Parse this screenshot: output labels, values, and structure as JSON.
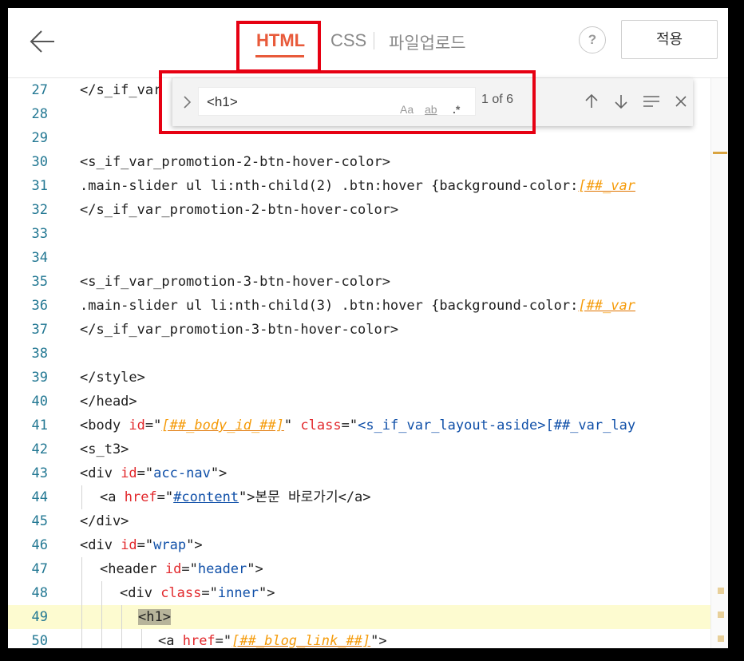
{
  "header": {
    "tabs": [
      {
        "label": "HTML",
        "active": true
      },
      {
        "label": "CSS",
        "active": false
      },
      {
        "label": "파일업로드",
        "active": false
      }
    ],
    "help_label": "?",
    "apply_label": "적용",
    "back_icon": "arrow-left-icon"
  },
  "find": {
    "query": "<h1>",
    "match_case_label": "Aa",
    "whole_word_label": "ab",
    "regex_label": ".*",
    "count": "1 of 6"
  },
  "editor": {
    "lines": [
      {
        "n": "27",
        "text": "</s_if_var"
      },
      {
        "n": "28",
        "text": ""
      },
      {
        "n": "29",
        "text": ""
      },
      {
        "n": "30",
        "text": "<s_if_var_promotion-2-btn-hover-color>"
      },
      {
        "n": "31",
        "text": ".main-slider ul li:nth-child(2) .btn:hover {background-color:[##_var"
      },
      {
        "n": "32",
        "text": "</s_if_var_promotion-2-btn-hover-color>"
      },
      {
        "n": "33",
        "text": ""
      },
      {
        "n": "34",
        "text": ""
      },
      {
        "n": "35",
        "text": "<s_if_var_promotion-3-btn-hover-color>"
      },
      {
        "n": "36",
        "text": ".main-slider ul li:nth-child(3) .btn:hover {background-color:[##_var"
      },
      {
        "n": "37",
        "text": "</s_if_var_promotion-3-btn-hover-color>"
      },
      {
        "n": "38",
        "text": ""
      },
      {
        "n": "39",
        "text": "</style>"
      },
      {
        "n": "40",
        "text": "</head>"
      },
      {
        "n": "41",
        "text": "<body id=\"[##_body_id_##]\" class=\"<s_if_var_layout-aside>[##_var_lay"
      },
      {
        "n": "42",
        "text": "<s_t3>"
      },
      {
        "n": "43",
        "text": "<div id=\"acc-nav\">"
      },
      {
        "n": "44",
        "text": "<a href=\"#content\">본문 바로가기</a>"
      },
      {
        "n": "45",
        "text": "</div>"
      },
      {
        "n": "46",
        "text": "<div id=\"wrap\">"
      },
      {
        "n": "47",
        "text": "<header id=\"header\">"
      },
      {
        "n": "48",
        "text": "<div class=\"inner\">"
      },
      {
        "n": "49",
        "text": "<h1>"
      },
      {
        "n": "50",
        "text": "<a href=\"[##_blog_link_##]\">"
      }
    ]
  }
}
